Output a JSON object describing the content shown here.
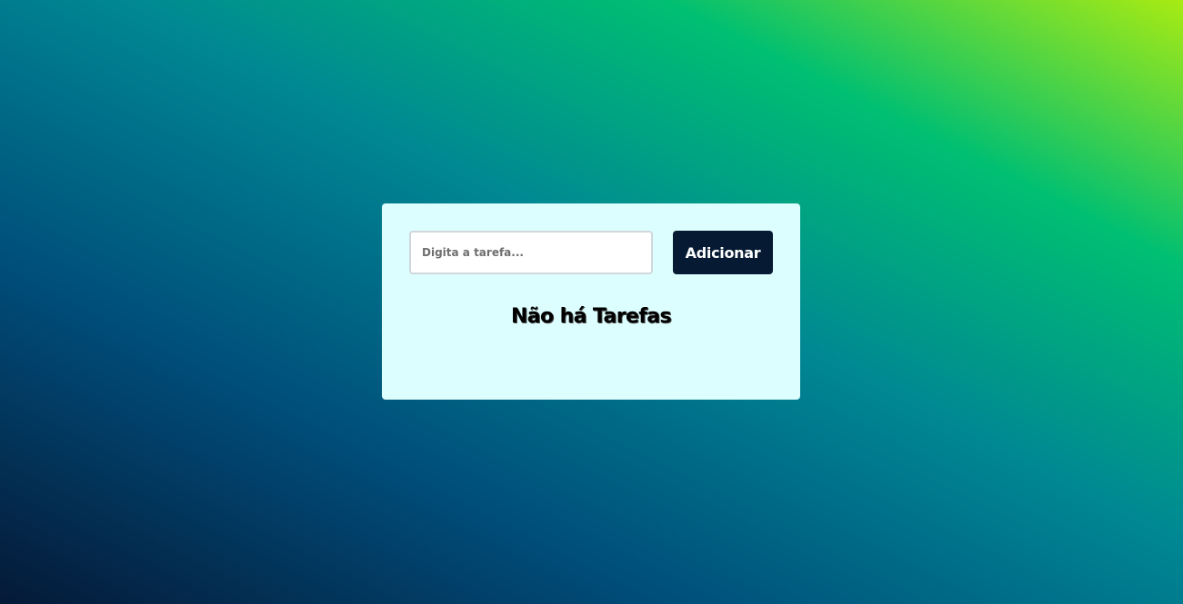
{
  "todo": {
    "input": {
      "placeholder": "Digita a tarefa...",
      "value": ""
    },
    "add_button_label": "Adicionar",
    "empty_message": "Não há Tarefas"
  },
  "colors": {
    "card_background": "#ddfefe",
    "button_background": "#061a33",
    "gradient": [
      "#051937",
      "#004d7a",
      "#008793",
      "#00bf72",
      "#a8eb12"
    ]
  }
}
